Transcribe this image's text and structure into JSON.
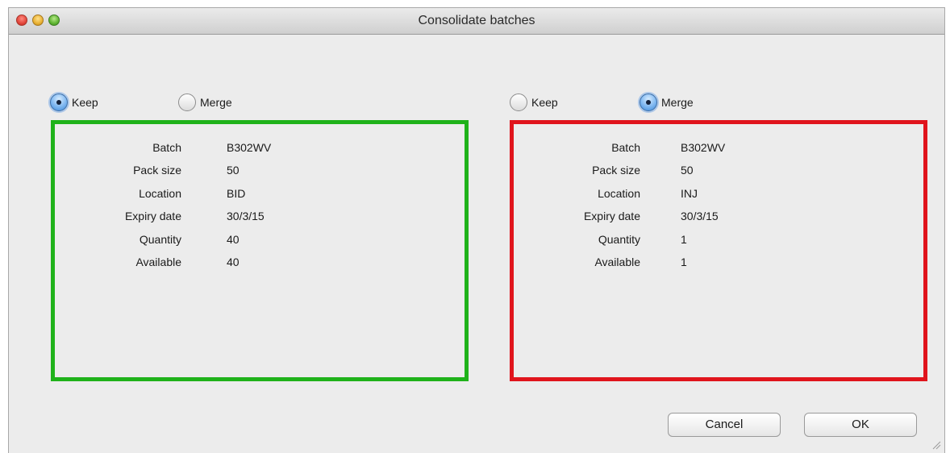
{
  "window": {
    "title": "Consolidate batches"
  },
  "left": {
    "options": {
      "keep": "Keep",
      "merge": "Merge",
      "selected": "Keep"
    },
    "border_color": "#1fb21a",
    "fields": [
      {
        "label": "Batch",
        "value": "B302WV"
      },
      {
        "label": "Pack size",
        "value": "50"
      },
      {
        "label": "Location",
        "value": "BID"
      },
      {
        "label": "Expiry date",
        "value": "30/3/15"
      },
      {
        "label": "Quantity",
        "value": "40"
      },
      {
        "label": "Available",
        "value": "40"
      }
    ]
  },
  "right": {
    "options": {
      "keep": "Keep",
      "merge": "Merge",
      "selected": "Merge"
    },
    "border_color": "#e0141c",
    "fields": [
      {
        "label": "Batch",
        "value": "B302WV"
      },
      {
        "label": "Pack size",
        "value": "50"
      },
      {
        "label": "Location",
        "value": "INJ"
      },
      {
        "label": "Expiry date",
        "value": "30/3/15"
      },
      {
        "label": "Quantity",
        "value": "1"
      },
      {
        "label": "Available",
        "value": "1"
      }
    ]
  },
  "buttons": {
    "cancel": "Cancel",
    "ok": "OK"
  },
  "icons": {
    "close": "close-icon",
    "minimize": "minimize-icon",
    "zoom": "zoom-icon",
    "resize": "resize-grip-icon"
  }
}
